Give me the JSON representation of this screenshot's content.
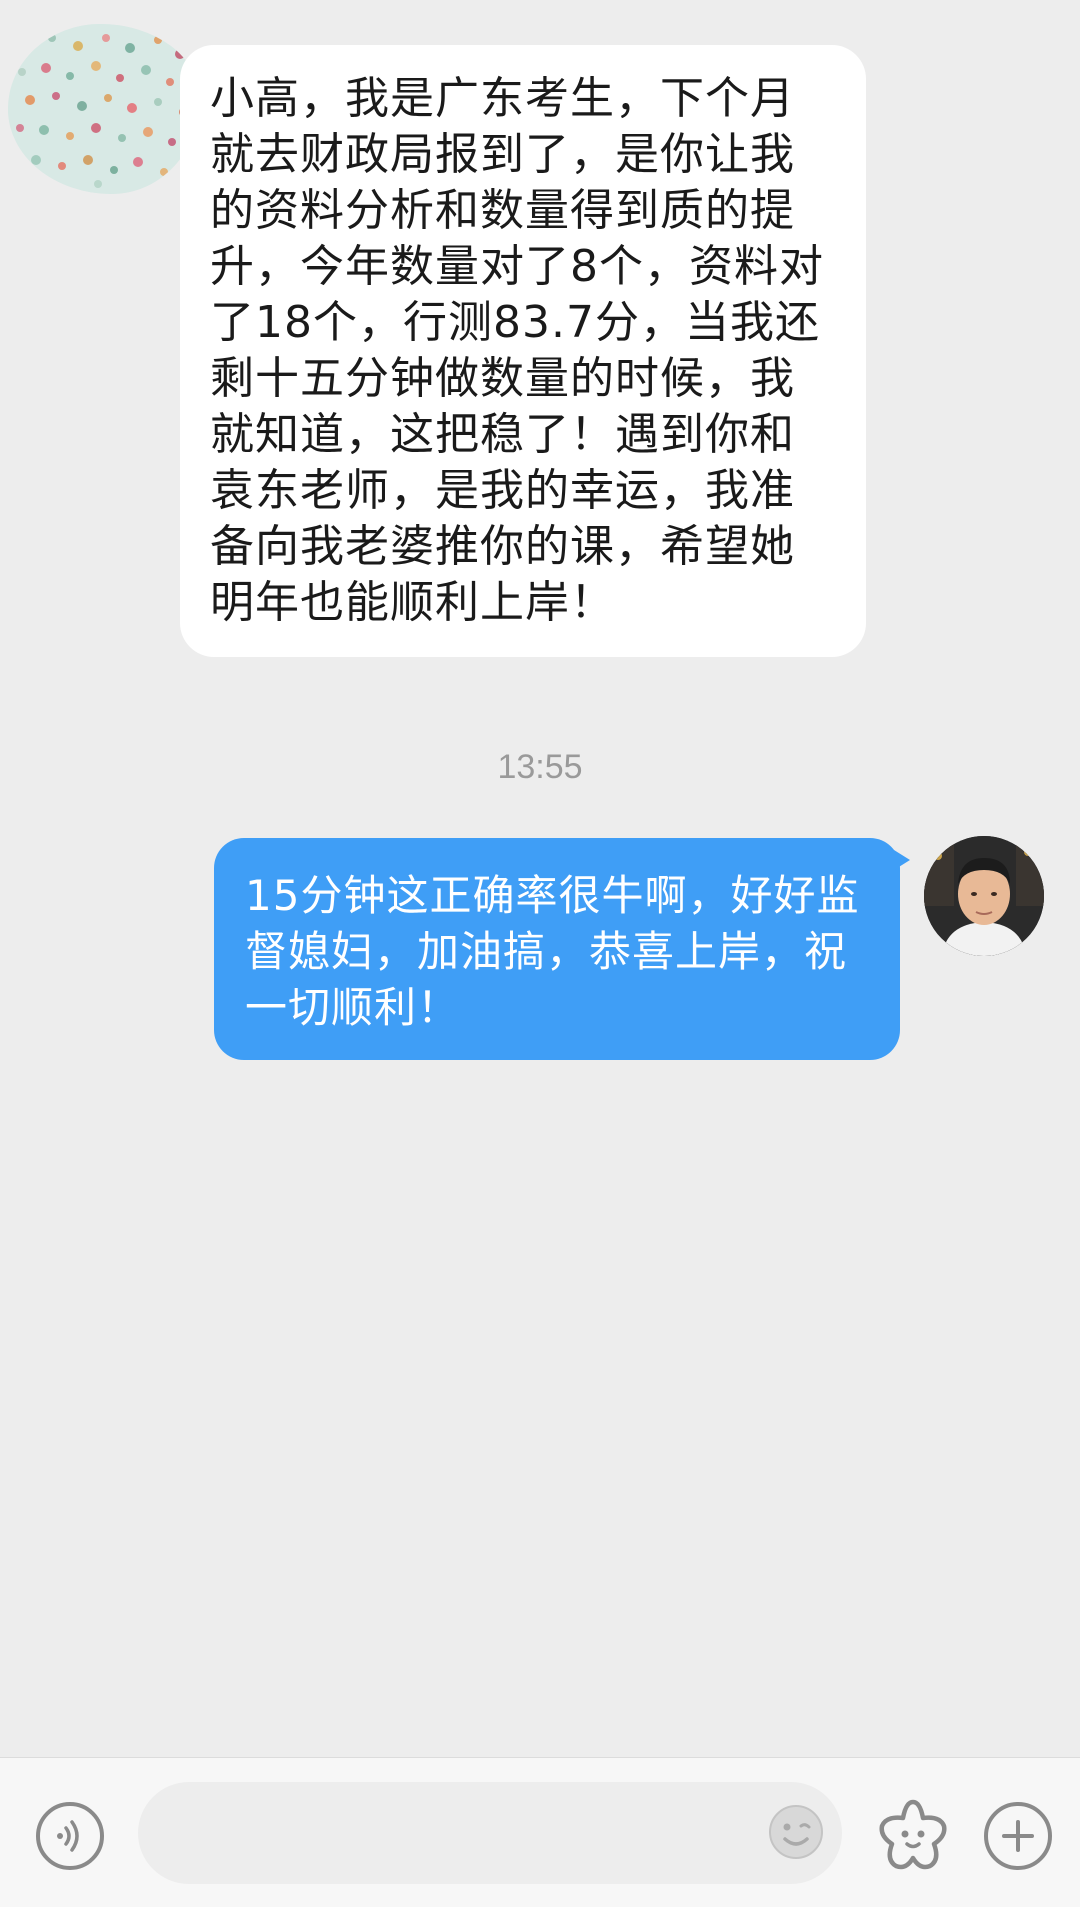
{
  "chat": {
    "incoming_message": "小高，我是广东考生，下个月就去财政局报到了，是你让我的资料分析和数量得到质的提升，今年数量对了8个，资料对了18个，行测83.7分，当我还剩十五分钟做数量的时候，我就知道，这把稳了！遇到你和袁东老师，是我的幸运，我准备向我老婆推你的课，希望她明年也能顺利上岸！",
    "timestamp": "13:55",
    "outgoing_message": "15分钟这正确率很牛啊，好好监督媳妇，加油搞，恭喜上岸，祝一切顺利！"
  },
  "input_bar": {
    "text_value": "",
    "icons": {
      "voice": "voice-icon",
      "sticker": "sticker-emoji-icon",
      "emoji": "emoji-face-icon",
      "more": "plus-icon"
    }
  },
  "colors": {
    "background": "#ededed",
    "incoming_bubble": "#ffffff",
    "outgoing_bubble": "#3f9ef6",
    "timestamp_text": "#9a9a9a",
    "icon_gray": "#8a8a8a"
  }
}
